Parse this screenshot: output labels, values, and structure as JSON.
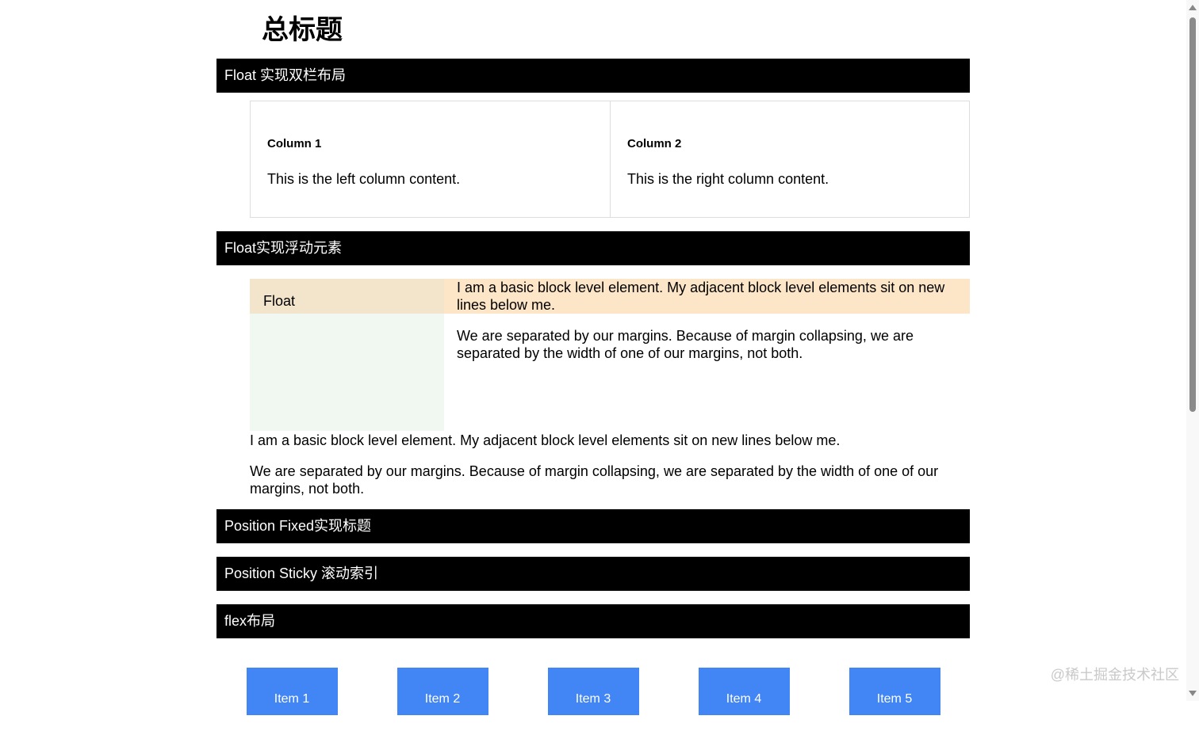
{
  "page_title": "总标题",
  "sections": {
    "float_columns": "Float 实现双栏布局",
    "float_element": "Float实现浮动元素",
    "position_fixed": "Position Fixed实现标题",
    "position_sticky": "Position Sticky 滚动索引",
    "flex_layout": "flex布局"
  },
  "columns": [
    {
      "heading": "Column 1",
      "text": "This is the left column content."
    },
    {
      "heading": "Column 2",
      "text": "This is the right column content."
    }
  ],
  "float_demo": {
    "float_label": "Float",
    "block_1": "I am a basic block level element. My adjacent block level elements sit on new lines below me.",
    "block_2": "We are separated by our margins. Because of margin collapsing, we are separated by the width of one of our margins, not both."
  },
  "paragraphs": [
    "I am a basic block level element. My adjacent block level elements sit on new lines below me.",
    "We are separated by our margins. Because of margin collapsing, we are separated by the width of one of our margins, not both."
  ],
  "flex_items": [
    "Item 1",
    "Item 2",
    "Item 3",
    "Item 4",
    "Item 5"
  ],
  "watermark": "@稀土掘金技术社区",
  "colors": {
    "section_bar": "#000000",
    "float_block_bg": "#fde6c7",
    "float_box_bg": "#f1f7f1",
    "flex_item_bg": "#4285f4"
  }
}
